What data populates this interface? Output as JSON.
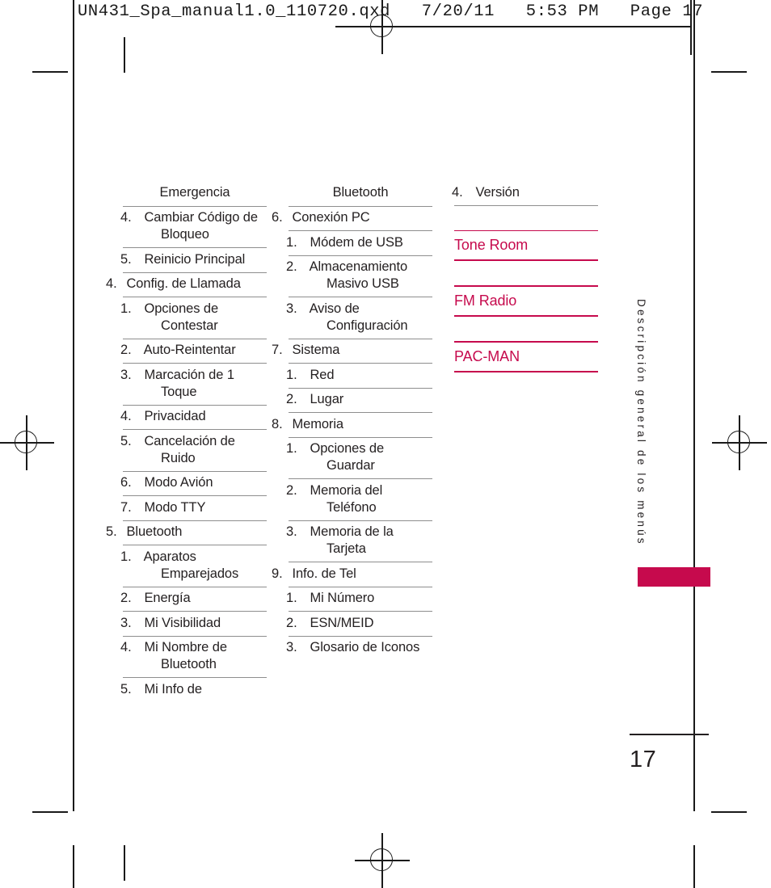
{
  "print_header": {
    "text": "UN431_Spa_manual1.0_110720.qxd   7/20/11   5:53 PM   Page 17"
  },
  "colors": {
    "magenta": "#c60a4d",
    "text": "#231f20",
    "rule": "#8e8e8e"
  },
  "side_tab": {
    "label": "Descripción general de los menús"
  },
  "page_number": "17",
  "columns": [
    {
      "name": "column-1",
      "blocks": [
        {
          "kind": "continuation",
          "text": "Emergencia"
        },
        {
          "kind": "rule"
        },
        {
          "kind": "item",
          "level": 2,
          "num": "4.",
          "text": "Cambiar Código de Bloqueo"
        },
        {
          "kind": "rule"
        },
        {
          "kind": "item",
          "level": 2,
          "num": "5.",
          "text": "Reinicio Principal"
        },
        {
          "kind": "rule"
        },
        {
          "kind": "item",
          "level": 1,
          "num": "4.",
          "text": "Config. de Llamada"
        },
        {
          "kind": "rule"
        },
        {
          "kind": "item",
          "level": 2,
          "num": "1.",
          "text": "Opciones de Contestar"
        },
        {
          "kind": "rule"
        },
        {
          "kind": "item",
          "level": 2,
          "num": "2.",
          "text": "Auto-Reintentar"
        },
        {
          "kind": "rule"
        },
        {
          "kind": "item",
          "level": 2,
          "num": "3.",
          "text": "Marcación de 1 Toque"
        },
        {
          "kind": "rule"
        },
        {
          "kind": "item",
          "level": 2,
          "num": "4.",
          "text": "Privacidad"
        },
        {
          "kind": "rule"
        },
        {
          "kind": "item",
          "level": 2,
          "num": "5.",
          "text": "Cancelación de Ruido"
        },
        {
          "kind": "rule"
        },
        {
          "kind": "item",
          "level": 2,
          "num": "6.",
          "text": "Modo Avión"
        },
        {
          "kind": "rule"
        },
        {
          "kind": "item",
          "level": 2,
          "num": "7.",
          "text": "Modo TTY"
        },
        {
          "kind": "rule"
        },
        {
          "kind": "item",
          "level": 1,
          "num": "5.",
          "text": "Bluetooth"
        },
        {
          "kind": "rule"
        },
        {
          "kind": "item",
          "level": 2,
          "num": "1.",
          "text": "Aparatos Emparejados"
        },
        {
          "kind": "rule"
        },
        {
          "kind": "item",
          "level": 2,
          "num": "2.",
          "text": "Energía"
        },
        {
          "kind": "rule"
        },
        {
          "kind": "item",
          "level": 2,
          "num": "3.",
          "text": "Mi Visibilidad"
        },
        {
          "kind": "rule"
        },
        {
          "kind": "item",
          "level": 2,
          "num": "4.",
          "text": "Mi Nombre de Bluetooth"
        },
        {
          "kind": "rule"
        },
        {
          "kind": "item",
          "level": 2,
          "num": "5.",
          "text": "Mi Info de"
        }
      ]
    },
    {
      "name": "column-2",
      "blocks": [
        {
          "kind": "continuation",
          "text": "Bluetooth"
        },
        {
          "kind": "rule"
        },
        {
          "kind": "item",
          "level": 1,
          "num": "6.",
          "text": "Conexión PC"
        },
        {
          "kind": "rule"
        },
        {
          "kind": "item",
          "level": 2,
          "num": "1.",
          "text": "Módem de USB"
        },
        {
          "kind": "rule"
        },
        {
          "kind": "item",
          "level": 2,
          "num": "2.",
          "text": "Almacenamiento Masivo USB"
        },
        {
          "kind": "rule"
        },
        {
          "kind": "item",
          "level": 2,
          "num": "3.",
          "text": "Aviso de Configuración"
        },
        {
          "kind": "rule"
        },
        {
          "kind": "item",
          "level": 1,
          "num": "7.",
          "text": "Sistema"
        },
        {
          "kind": "rule"
        },
        {
          "kind": "item",
          "level": 2,
          "num": "1.",
          "text": "Red"
        },
        {
          "kind": "rule"
        },
        {
          "kind": "item",
          "level": 2,
          "num": "2.",
          "text": "Lugar"
        },
        {
          "kind": "rule"
        },
        {
          "kind": "item",
          "level": 1,
          "num": "8.",
          "text": "Memoria"
        },
        {
          "kind": "rule"
        },
        {
          "kind": "item",
          "level": 2,
          "num": "1.",
          "text": "Opciones de Guardar"
        },
        {
          "kind": "rule"
        },
        {
          "kind": "item",
          "level": 2,
          "num": "2.",
          "text": "Memoria del Teléfono"
        },
        {
          "kind": "rule"
        },
        {
          "kind": "item",
          "level": 2,
          "num": "3.",
          "text": "Memoria de la Tarjeta"
        },
        {
          "kind": "rule"
        },
        {
          "kind": "item",
          "level": 1,
          "num": "9.",
          "text": "Info. de Tel"
        },
        {
          "kind": "rule"
        },
        {
          "kind": "item",
          "level": 2,
          "num": "1.",
          "text": "Mi Número"
        },
        {
          "kind": "rule"
        },
        {
          "kind": "item",
          "level": 2,
          "num": "2.",
          "text": "ESN/MEID"
        },
        {
          "kind": "rule"
        },
        {
          "kind": "item",
          "level": 2,
          "num": "3.",
          "text": "Glosario de Iconos"
        }
      ]
    },
    {
      "name": "column-3",
      "blocks": [
        {
          "kind": "item",
          "level": 2,
          "num": "4.",
          "text": "Versión"
        },
        {
          "kind": "rule"
        },
        {
          "kind": "gap"
        },
        {
          "kind": "rule_magenta"
        },
        {
          "kind": "magenta_head",
          "text": "Tone Room"
        },
        {
          "kind": "rule_magenta"
        },
        {
          "kind": "gap"
        },
        {
          "kind": "rule_magenta"
        },
        {
          "kind": "magenta_head",
          "text": "FM Radio"
        },
        {
          "kind": "rule_magenta"
        },
        {
          "kind": "gap"
        },
        {
          "kind": "rule_magenta"
        },
        {
          "kind": "magenta_head",
          "text": "PAC-MAN"
        },
        {
          "kind": "rule_magenta"
        }
      ]
    }
  ]
}
